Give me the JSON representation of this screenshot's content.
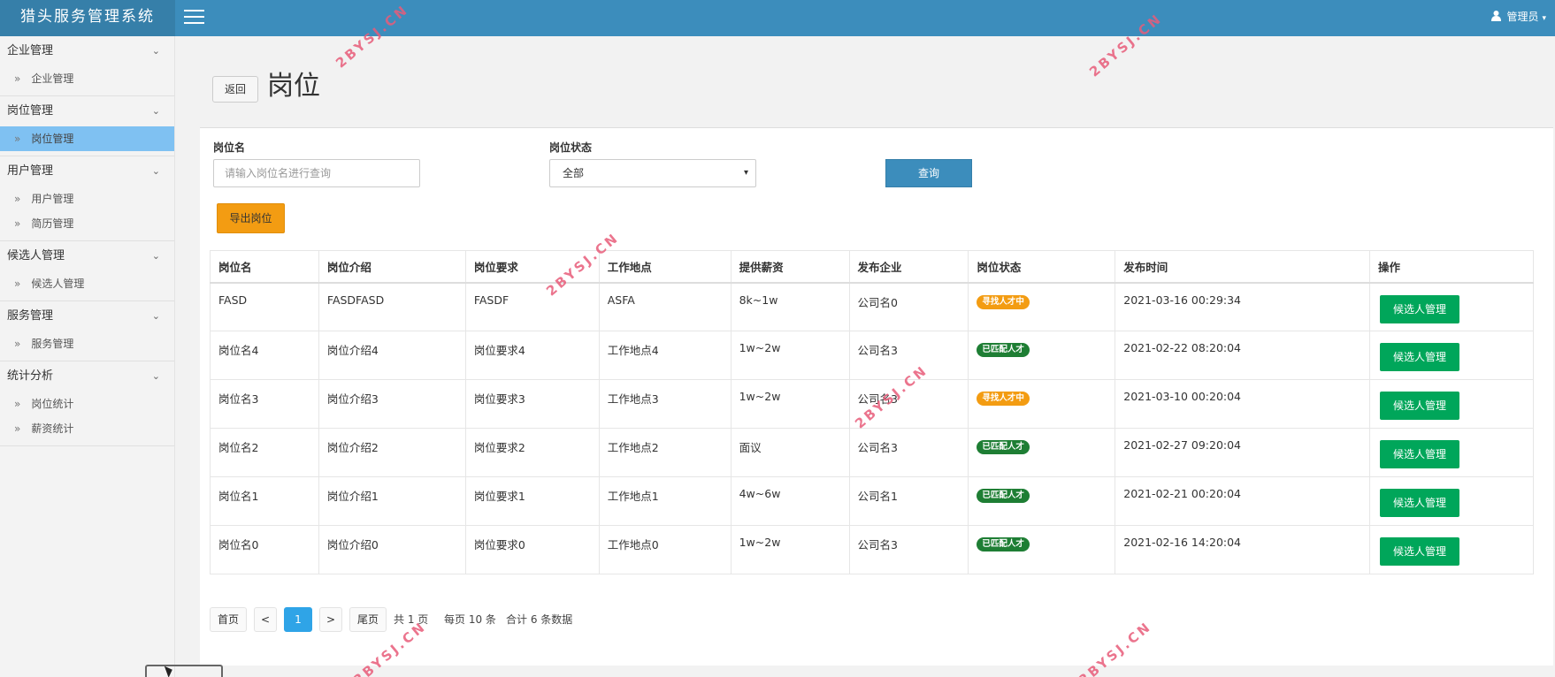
{
  "app": {
    "title": "猎头服务管理系统",
    "user": "管理员"
  },
  "sidebar": [
    {
      "label": "企业管理",
      "items": [
        "企业管理"
      ]
    },
    {
      "label": "岗位管理",
      "items": [
        "岗位管理"
      ]
    },
    {
      "label": "用户管理",
      "items": [
        "用户管理",
        "简历管理"
      ]
    },
    {
      "label": "候选人管理",
      "items": [
        "候选人管理"
      ]
    },
    {
      "label": "服务管理",
      "items": [
        "服务管理"
      ]
    },
    {
      "label": "统计分析",
      "items": [
        "岗位统计",
        "薪资统计"
      ]
    }
  ],
  "page": {
    "back": "返回",
    "title": "岗位"
  },
  "search": {
    "name_label": "岗位名",
    "name_placeholder": "请输入岗位名进行查询",
    "status_label": "岗位状态",
    "status_value": "全部",
    "query": "查询",
    "export": "导出岗位"
  },
  "table": {
    "headers": [
      "岗位名",
      "岗位介绍",
      "岗位要求",
      "工作地点",
      "提供薪资",
      "发布企业",
      "岗位状态",
      "发布时间",
      "操作"
    ],
    "rows": [
      {
        "name": "FASD",
        "intro": "FASDFASD",
        "req": "FASDF",
        "loc": "ASFA",
        "salary": "8k~1w",
        "company": "公司名0",
        "status": "寻找人才中",
        "time": "2021-03-16 00:29:34",
        "action": "候选人管理"
      },
      {
        "name": "岗位名4",
        "intro": "岗位介绍4",
        "req": "岗位要求4",
        "loc": "工作地点4",
        "salary": "1w~2w",
        "company": "公司名3",
        "status": "已匹配人才",
        "time": "2021-02-22 08:20:04",
        "action": "候选人管理"
      },
      {
        "name": "岗位名3",
        "intro": "岗位介绍3",
        "req": "岗位要求3",
        "loc": "工作地点3",
        "salary": "1w~2w",
        "company": "公司名3",
        "status": "寻找人才中",
        "time": "2021-03-10 00:20:04",
        "action": "候选人管理"
      },
      {
        "name": "岗位名2",
        "intro": "岗位介绍2",
        "req": "岗位要求2",
        "loc": "工作地点2",
        "salary": "面议",
        "company": "公司名3",
        "status": "已匹配人才",
        "time": "2021-02-27 09:20:04",
        "action": "候选人管理"
      },
      {
        "name": "岗位名1",
        "intro": "岗位介绍1",
        "req": "岗位要求1",
        "loc": "工作地点1",
        "salary": "4w~6w",
        "company": "公司名1",
        "status": "已匹配人才",
        "time": "2021-02-21 00:20:04",
        "action": "候选人管理"
      },
      {
        "name": "岗位名0",
        "intro": "岗位介绍0",
        "req": "岗位要求0",
        "loc": "工作地点0",
        "salary": "1w~2w",
        "company": "公司名3",
        "status": "已匹配人才",
        "time": "2021-02-16 14:20:04",
        "action": "候选人管理"
      }
    ]
  },
  "status_colors": {
    "寻找人才中": "#f39c12",
    "已匹配人才": "#1e7e34"
  },
  "pager": {
    "first": "首页",
    "prev": "<",
    "current": "1",
    "next": ">",
    "last": "尾页",
    "total_pages": "共 1 页",
    "per_page": "每页 10 条",
    "total": "合计 6 条数据"
  },
  "watermark": "2BYSJ.CN",
  "icons": {
    "menu": "hamburger-icon",
    "user": "user-icon",
    "chevron": "chevron-down-icon",
    "arrow": "double-angle-right-icon"
  }
}
